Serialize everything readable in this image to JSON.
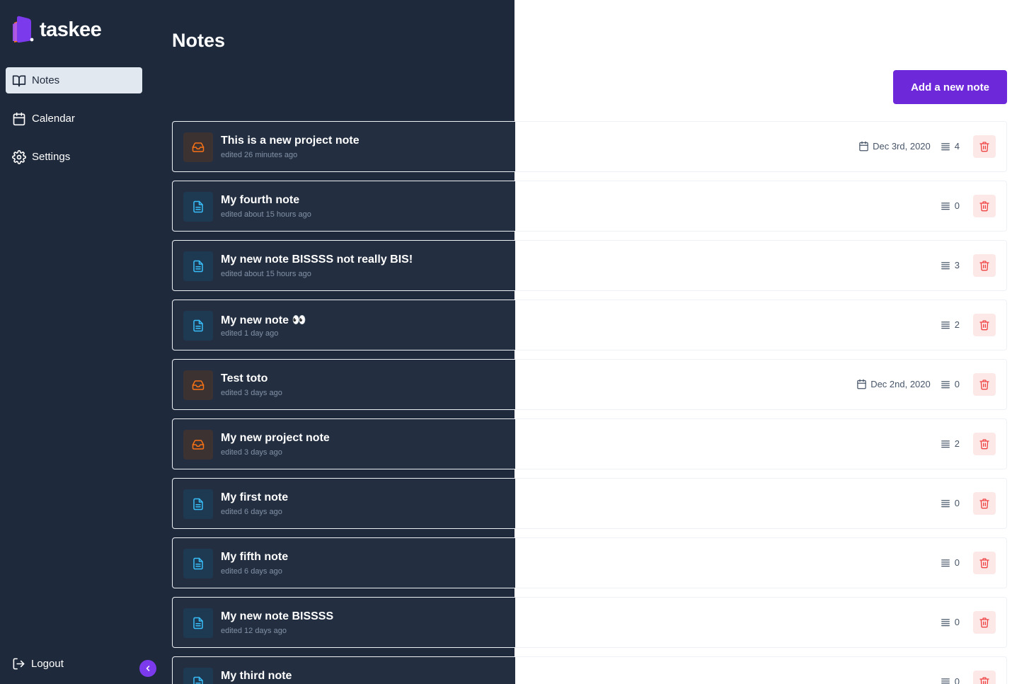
{
  "app": {
    "name": "taskee"
  },
  "sidebar": {
    "items": [
      {
        "label": "Notes",
        "icon": "book-icon",
        "active": true
      },
      {
        "label": "Calendar",
        "icon": "calendar-icon",
        "active": false
      },
      {
        "label": "Settings",
        "icon": "gear-icon",
        "active": false
      }
    ],
    "logout_label": "Logout"
  },
  "page": {
    "title": "Notes",
    "add_button_label": "Add a new note"
  },
  "colors": {
    "sidebar_bg": "#1e293b",
    "accent": "#6d28d9",
    "project_icon": "#f97316",
    "doc_icon": "#38bdf8",
    "delete": "#ef4444"
  },
  "notes": [
    {
      "title": "This is a new project note",
      "edited": "edited 26 minutes ago",
      "type": "project",
      "date": "Dec 3rd, 2020",
      "count": "4"
    },
    {
      "title": "My fourth note",
      "edited": "edited about 15 hours ago",
      "type": "doc",
      "date": "",
      "count": "0"
    },
    {
      "title": "My new note BISSSS not really BIS!",
      "edited": "edited about 15 hours ago",
      "type": "doc",
      "date": "",
      "count": "3"
    },
    {
      "title": "My new note 👀",
      "edited": "edited 1 day ago",
      "type": "doc",
      "date": "",
      "count": "2"
    },
    {
      "title": "Test toto",
      "edited": "edited 3 days ago",
      "type": "project",
      "date": "Dec 2nd, 2020",
      "count": "0"
    },
    {
      "title": "My new project note",
      "edited": "edited 3 days ago",
      "type": "project",
      "date": "",
      "count": "2"
    },
    {
      "title": "My first note",
      "edited": "edited 6 days ago",
      "type": "doc",
      "date": "",
      "count": "0"
    },
    {
      "title": "My fifth note",
      "edited": "edited 6 days ago",
      "type": "doc",
      "date": "",
      "count": "0"
    },
    {
      "title": "My new note BISSSS",
      "edited": "edited 12 days ago",
      "type": "doc",
      "date": "",
      "count": "0"
    },
    {
      "title": "My third note",
      "edited": "",
      "type": "doc",
      "date": "",
      "count": "0"
    }
  ]
}
